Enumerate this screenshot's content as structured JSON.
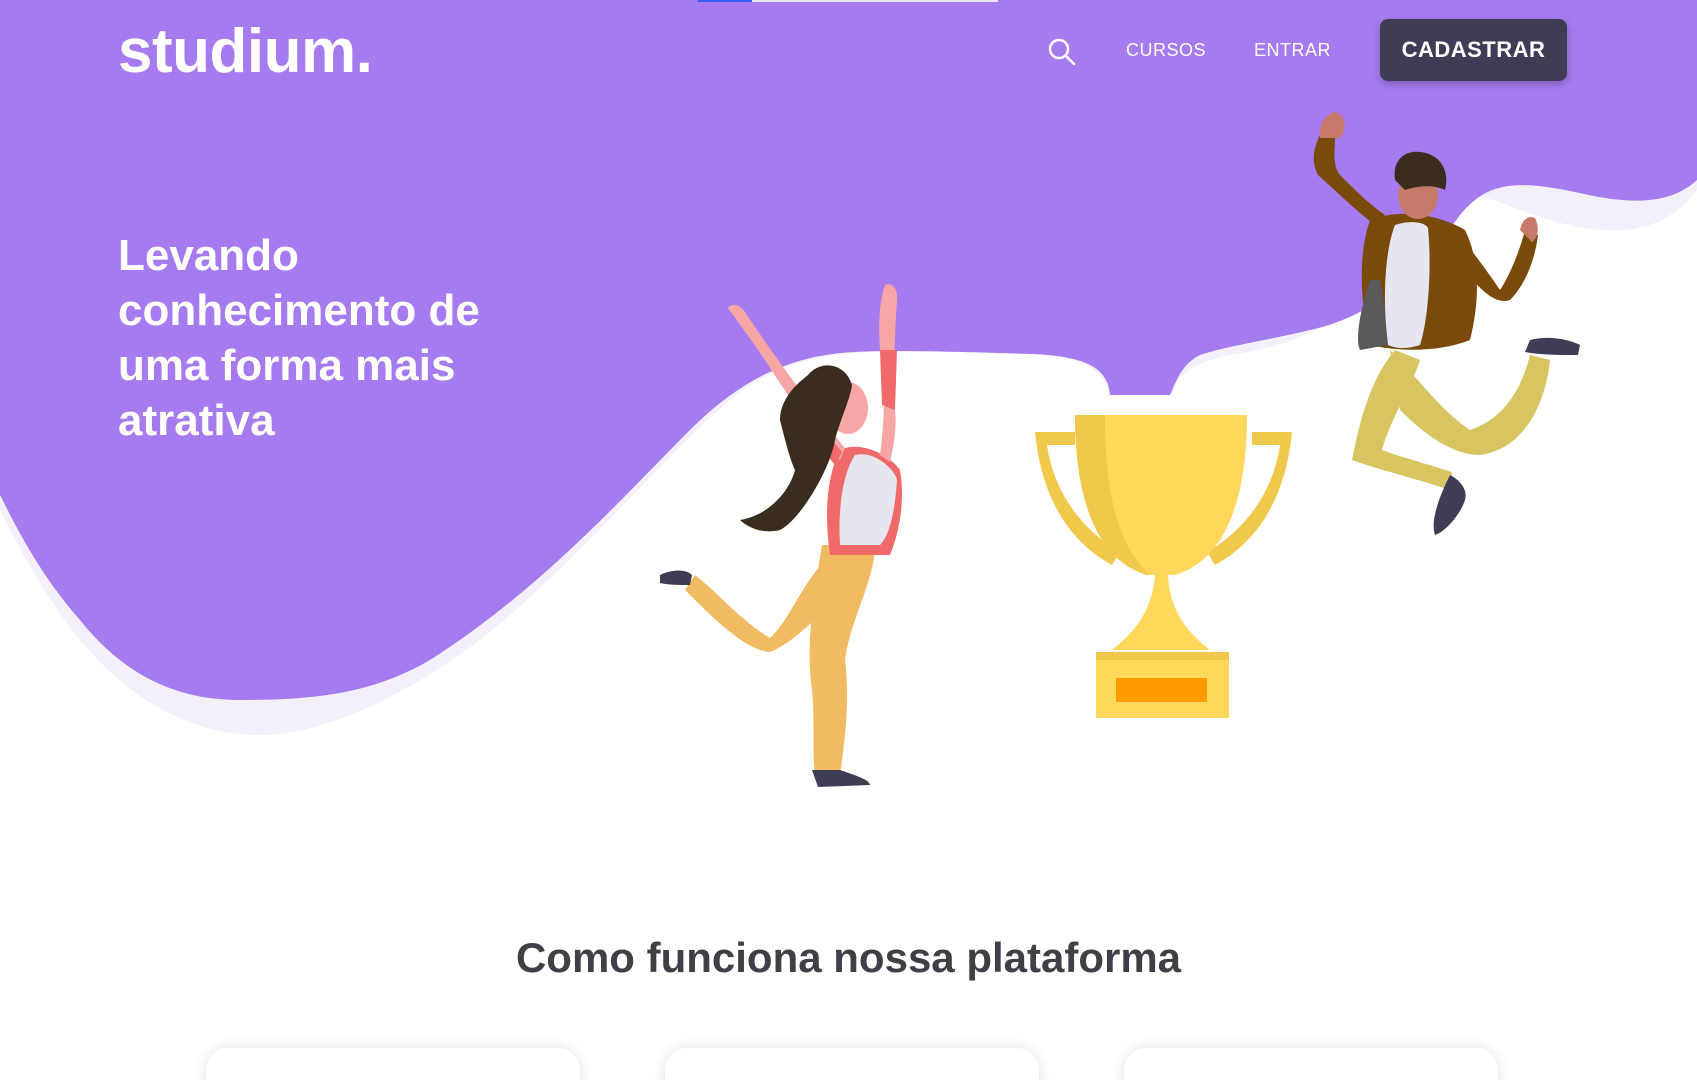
{
  "brand": {
    "logo": "studium."
  },
  "nav": {
    "search_icon": "search-icon",
    "links": [
      {
        "label": "CURSOS"
      },
      {
        "label": "ENTRAR"
      }
    ],
    "signup_label": "CADASTRAR"
  },
  "hero": {
    "headline": "Levando conhecimento de uma forma mais atrativa"
  },
  "scroll_progress": 0.18,
  "features": {
    "title": "Como funciona nossa plataforma",
    "cards": [
      {},
      {},
      {}
    ]
  },
  "colors": {
    "hero_purple": "#a67bef",
    "hero_wave_light": "#f3f0fc",
    "button_dark": "#3f3d56",
    "heading_dark": "#3f3f46",
    "trophy_gold": "#ffd75a",
    "progress_blue": "#3b5cf0"
  }
}
